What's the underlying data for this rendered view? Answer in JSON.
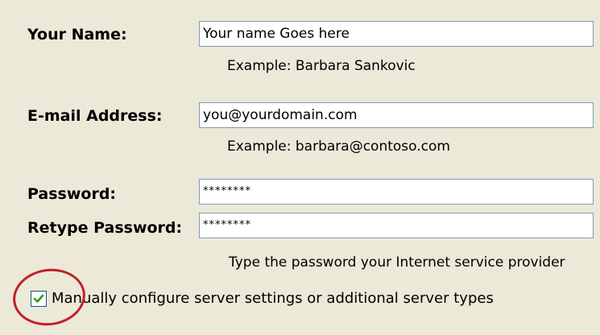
{
  "form": {
    "name_label": "Your Name:",
    "name_value": "Your name Goes here",
    "name_hint": "Example: Barbara Sankovic",
    "email_label": "E-mail Address:",
    "email_value": "you@yourdomain.com",
    "email_hint": "Example: barbara@contoso.com",
    "password_label": "Password:",
    "password_value": "********",
    "retype_label": "Retype Password:",
    "retype_value": "********",
    "password_hint": "Type the password your Internet service provider",
    "manual_config_label": "Manually configure server settings or additional server types",
    "manual_config_checked": true
  },
  "annotation": {
    "circle_color": "#c0202a",
    "target": "manual-config-checkbox"
  }
}
